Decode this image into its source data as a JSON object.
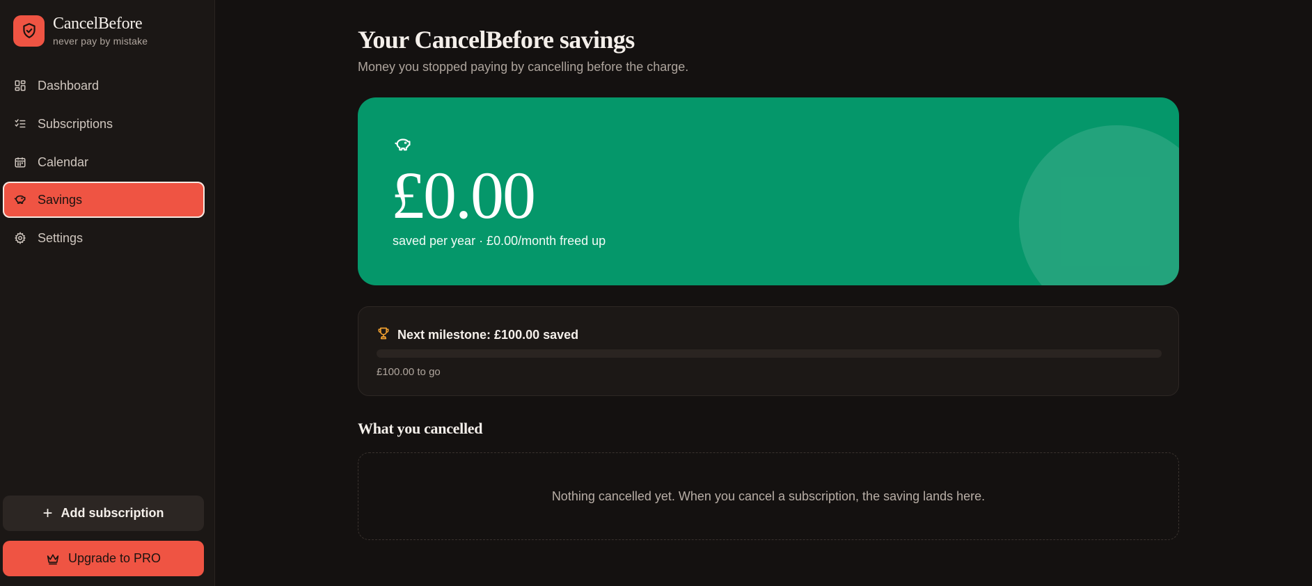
{
  "brand": {
    "name": "CancelBefore",
    "tagline": "never pay by mistake"
  },
  "nav": {
    "items": [
      {
        "label": "Dashboard",
        "icon": "dashboard-icon",
        "active": false
      },
      {
        "label": "Subscriptions",
        "icon": "checklist-icon",
        "active": false
      },
      {
        "label": "Calendar",
        "icon": "calendar-icon",
        "active": false
      },
      {
        "label": "Savings",
        "icon": "piggy-bank-icon",
        "active": true
      },
      {
        "label": "Settings",
        "icon": "gear-icon",
        "active": false
      }
    ]
  },
  "sidebar_actions": {
    "add_label": "Add subscription",
    "upgrade_label": "Upgrade to PRO"
  },
  "page": {
    "title": "Your CancelBefore savings",
    "subtitle": "Money you stopped paying by cancelling before the charge."
  },
  "hero": {
    "amount": "£0.00",
    "caption": "saved per year · £0.00/month freed up",
    "icon": "piggy-bank-icon"
  },
  "milestone": {
    "title": "Next milestone: £100.00 saved",
    "progress": 0,
    "remaining": "£100.00 to go",
    "icon": "trophy-icon"
  },
  "cancelled": {
    "title": "What you cancelled",
    "empty_text": "Nothing cancelled yet. When you cancel a subscription, the saving lands here."
  },
  "colors": {
    "accent": "#ef5443",
    "hero_green": "#05976a",
    "background": "#141110",
    "sidebar": "#1b1715",
    "trophy": "#f0a030"
  }
}
